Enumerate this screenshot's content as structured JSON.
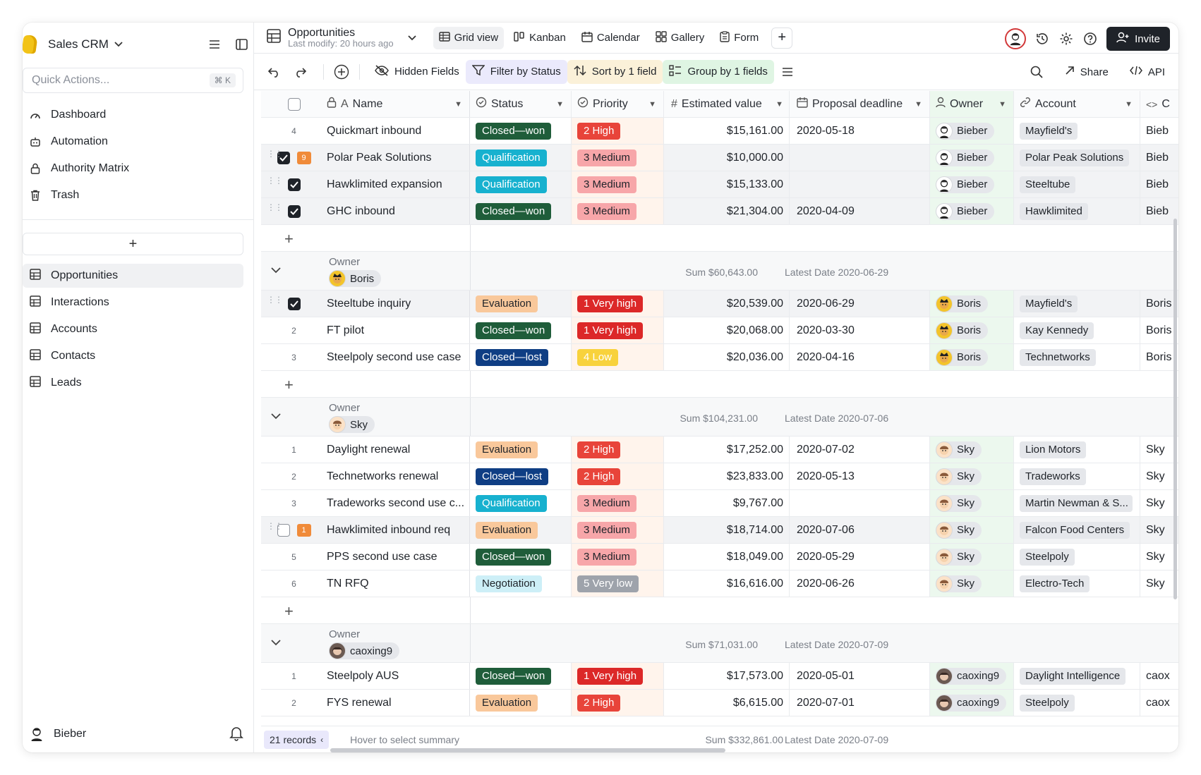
{
  "sidebar": {
    "app_title": "Sales CRM",
    "quick_actions_placeholder": "Quick Actions...",
    "quick_actions_shortcut": "⌘ K",
    "nav": [
      {
        "label": "Dashboard",
        "icon": "dashboard-icon"
      },
      {
        "label": "Automation",
        "icon": "robot-icon"
      },
      {
        "label": "Authority Matrix",
        "icon": "lock-icon"
      },
      {
        "label": "Trash",
        "icon": "trash-icon"
      }
    ],
    "tables": [
      {
        "label": "Opportunities",
        "active": true
      },
      {
        "label": "Interactions",
        "active": false
      },
      {
        "label": "Accounts",
        "active": false
      },
      {
        "label": "Contacts",
        "active": false
      },
      {
        "label": "Leads",
        "active": false
      }
    ],
    "user": "Bieber"
  },
  "topbar": {
    "view_title": "Opportunities",
    "view_subtitle": "Last modify: 20 hours ago",
    "views": [
      {
        "label": "Grid view",
        "icon": "grid-icon",
        "active": true
      },
      {
        "label": "Kanban",
        "icon": "kanban-icon",
        "active": false
      },
      {
        "label": "Calendar",
        "icon": "calendar-icon",
        "active": false
      },
      {
        "label": "Gallery",
        "icon": "gallery-icon",
        "active": false
      },
      {
        "label": "Form",
        "icon": "form-icon",
        "active": false
      }
    ],
    "invite_label": "Invite"
  },
  "toolbar": {
    "hidden_fields": "Hidden Fields",
    "filter": "Filter by Status",
    "sort": "Sort by 1 field",
    "group": "Group by 1 fields",
    "share": "Share",
    "api": "API"
  },
  "columns": {
    "name": "Name",
    "status": "Status",
    "priority": "Priority",
    "value": "Estimated value",
    "deadline": "Proposal deadline",
    "owner": "Owner",
    "account": "Account",
    "extra": "C"
  },
  "colors": {
    "closed_won": "#1f5d3a",
    "qualification": "#17b1cf",
    "evaluation": "#f9c89b",
    "closed_lost": "#0f3e84",
    "negotiation": "#cdeff7",
    "very_high": "#dc2828",
    "high": "#e8443a",
    "medium": "#f7a6a9",
    "low": "#f8d23c",
    "very_low": "#9ea3ab"
  },
  "groups": [
    {
      "owner": "Bieber",
      "partial": true,
      "rows": [
        {
          "num": "4",
          "name": "Quickmart inbound",
          "status": "Closed—won",
          "priority": "2 High",
          "value": "$15,161.00",
          "deadline": "2020-05-18",
          "owner": "Bieber",
          "account": "Mayfield's",
          "extra": "Bieb",
          "checked": null
        },
        {
          "num": "",
          "name": "Polar Peak Solutions",
          "status": "Qualification",
          "priority": "3 Medium",
          "value": "$10,000.00",
          "deadline": "",
          "owner": "Bieber",
          "account": "Polar Peak Solutions",
          "extra": "Bieb",
          "checked": true,
          "comments": "9"
        },
        {
          "num": "",
          "name": "Hawklimited expansion",
          "status": "Qualification",
          "priority": "3 Medium",
          "value": "$15,133.00",
          "deadline": "",
          "owner": "Bieber",
          "account": "Steeltube",
          "extra": "Bieb",
          "checked": true
        },
        {
          "num": "",
          "name": "GHC inbound",
          "status": "Closed—won",
          "priority": "3 Medium",
          "value": "$21,304.00",
          "deadline": "2020-04-09",
          "owner": "Bieber",
          "account": "Hawklimited",
          "extra": "Bieb",
          "checked": true
        }
      ]
    },
    {
      "label": "Owner",
      "owner": "Boris",
      "sum": "Sum $60,643.00",
      "latest": "Latest Date 2020-06-29",
      "rows": [
        {
          "num": "",
          "name": "Steeltube inquiry",
          "status": "Evaluation",
          "priority": "1 Very high",
          "value": "$20,539.00",
          "deadline": "2020-06-29",
          "owner": "Boris",
          "account": "Mayfield's",
          "extra": "Boris",
          "checked": true
        },
        {
          "num": "2",
          "name": "FT pilot",
          "status": "Closed—won",
          "priority": "1 Very high",
          "value": "$20,068.00",
          "deadline": "2020-03-30",
          "owner": "Boris",
          "account": "Kay Kennedy",
          "extra": "Boris",
          "checked": null
        },
        {
          "num": "3",
          "name": "Steelpoly second use case",
          "status": "Closed—lost",
          "priority": "4 Low",
          "value": "$20,036.00",
          "deadline": "2020-04-16",
          "owner": "Boris",
          "account": "Technetworks",
          "extra": "Boris",
          "checked": null
        }
      ]
    },
    {
      "label": "Owner",
      "owner": "Sky",
      "sum": "Sum $104,231.00",
      "latest": "Latest Date 2020-07-06",
      "rows": [
        {
          "num": "1",
          "name": "Daylight renewal",
          "status": "Evaluation",
          "priority": "2 High",
          "value": "$17,252.00",
          "deadline": "2020-07-02",
          "owner": "Sky",
          "account": "Lion Motors",
          "extra": "Sky",
          "checked": null
        },
        {
          "num": "2",
          "name": "Technetworks renewal",
          "status": "Closed—lost",
          "priority": "2 High",
          "value": "$23,833.00",
          "deadline": "2020-05-13",
          "owner": "Sky",
          "account": "Tradeworks",
          "extra": "Sky",
          "checked": null
        },
        {
          "num": "3",
          "name": "Tradeworks second use c...",
          "status": "Qualification",
          "priority": "3 Medium",
          "value": "$9,767.00",
          "deadline": "",
          "owner": "Sky",
          "account": "Martin Newman & S...",
          "extra": "Sky",
          "checked": null
        },
        {
          "num": "",
          "name": "Hawklimited inbound req",
          "status": "Evaluation",
          "priority": "3 Medium",
          "value": "$18,714.00",
          "deadline": "2020-07-06",
          "owner": "Sky",
          "account": "Falcon Food Centers",
          "extra": "Sky",
          "checked": false,
          "comments": "1"
        },
        {
          "num": "5",
          "name": "PPS second use case",
          "status": "Closed—won",
          "priority": "3 Medium",
          "value": "$18,049.00",
          "deadline": "2020-05-29",
          "owner": "Sky",
          "account": "Steelpoly",
          "extra": "Sky",
          "checked": null
        },
        {
          "num": "6",
          "name": "TN RFQ",
          "status": "Negotiation",
          "priority": "5 Very low",
          "value": "$16,616.00",
          "deadline": "2020-06-26",
          "owner": "Sky",
          "account": "Electro-Tech",
          "extra": "Sky",
          "checked": null
        }
      ]
    },
    {
      "label": "Owner",
      "owner": "caoxing9",
      "sum": "Sum $71,031.00",
      "latest": "Latest Date 2020-07-09",
      "rows": [
        {
          "num": "1",
          "name": "Steelpoly AUS",
          "status": "Closed—won",
          "priority": "1 Very high",
          "value": "$17,573.00",
          "deadline": "2020-05-01",
          "owner": "caoxing9",
          "account": "Daylight Intelligence",
          "extra": "caox",
          "checked": null
        },
        {
          "num": "2",
          "name": "FYS renewal",
          "status": "Evaluation",
          "priority": "2 High",
          "value": "$6,615.00",
          "deadline": "2020-07-01",
          "owner": "caoxing9",
          "account": "Steelpoly",
          "extra": "caox",
          "checked": null
        }
      ]
    }
  ],
  "footer": {
    "records": "21 records",
    "hover_hint": "Hover to select summary",
    "sum": "Sum $332,861.00",
    "latest": "Latest Date 2020-07-09"
  }
}
